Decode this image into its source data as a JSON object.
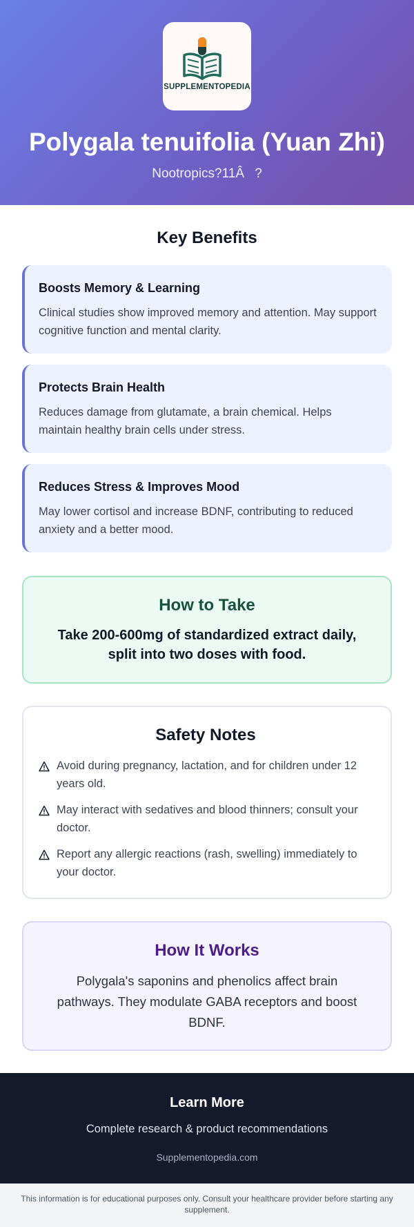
{
  "header": {
    "logo_text": "SUPPLEMENTOPEDIA",
    "title": "Polygala tenuifolia (Yuan Zhi)",
    "subtitle": "Nootropics?11Â?"
  },
  "benefits": {
    "title": "Key Benefits",
    "items": [
      {
        "title": "Boosts Memory & Learning",
        "description": "Clinical studies show improved memory and attention. May support cognitive function and mental clarity."
      },
      {
        "title": "Protects Brain Health",
        "description": "Reduces damage from glutamate, a brain chemical. Helps maintain healthy brain cells under stress."
      },
      {
        "title": "Reduces Stress & Improves Mood",
        "description": "May lower cortisol and increase BDNF, contributing to reduced anxiety and a better mood."
      }
    ]
  },
  "how_to_take": {
    "title": "How to Take",
    "text": "Take 200-600mg of standardized extract daily, split into two doses with food."
  },
  "safety": {
    "title": "Safety Notes",
    "icon": "warning-icon",
    "items": [
      "Avoid during pregnancy, lactation, and for children under 12 years old.",
      "May interact with sedatives and blood thinners; consult your doctor.",
      "Report any allergic reactions (rash, swelling) immediately to your doctor."
    ]
  },
  "how_it_works": {
    "title": "How It Works",
    "text": "Polygala's saponins and phenolics affect brain pathways. They modulate GABA receptors and boost BDNF."
  },
  "footer": {
    "title": "Learn More",
    "subtitle": "Complete research & product recommendations",
    "link": "Supplementopedia.com"
  },
  "disclaimer": "This information is for educational purposes only. Consult your healthcare provider before starting any supplement.",
  "colors": {
    "hero_gradient_start": "#6a7fe6",
    "hero_gradient_end": "#7650a9",
    "benefit_accent": "#6b73d9",
    "how_to_take_title": "#17513f",
    "how_it_works_title": "#4c1d87",
    "footer_bg": "#141a2c"
  }
}
